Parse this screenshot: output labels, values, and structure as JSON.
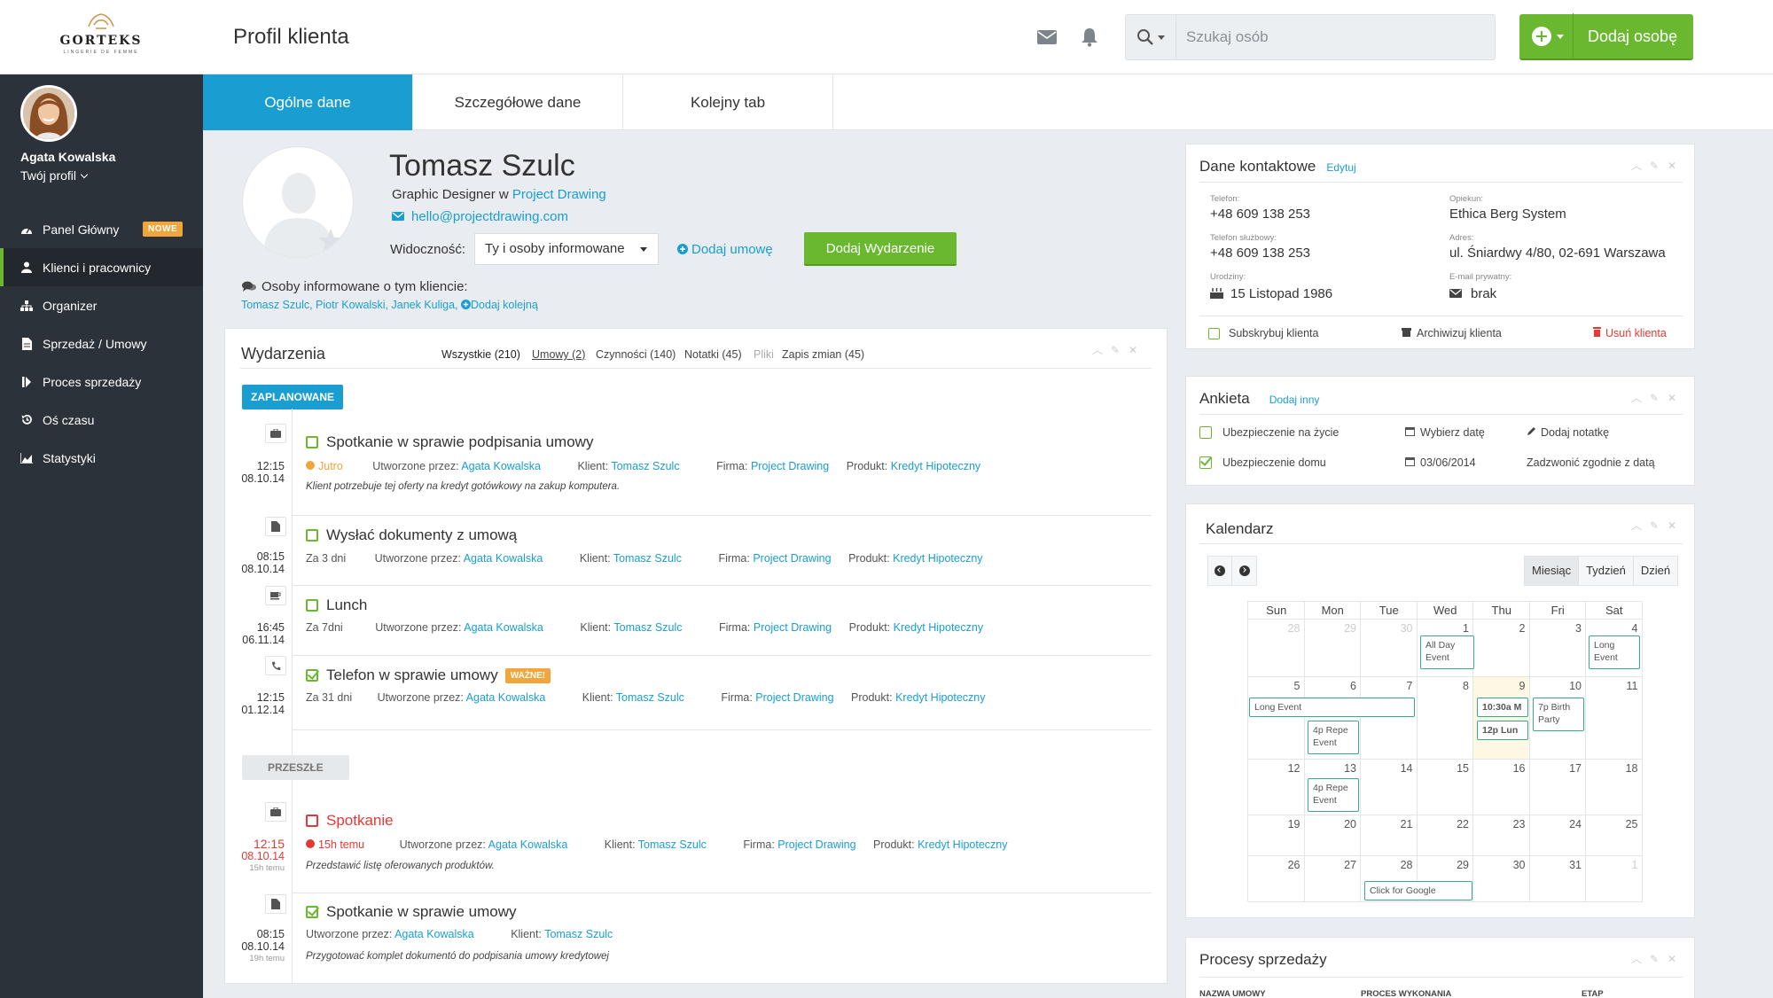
{
  "header": {
    "logo_brand": "GORTEKS",
    "logo_tagline": "LINGERIE DE FEMME",
    "page_title": "Profil klienta",
    "search_placeholder": "Szukaj osób",
    "add_person_label": "Dodaj osobę"
  },
  "sidebar": {
    "user_name": "Agata Kowalska",
    "user_profile_label": "Twój profil",
    "items": [
      {
        "label": "Panel Główny",
        "icon": "dashboard-icon",
        "badge": "NOWE"
      },
      {
        "label": "Klienci i pracownicy",
        "icon": "user-icon",
        "active": true
      },
      {
        "label": "Organizer",
        "icon": "organizer-icon"
      },
      {
        "label": "Sprzedaż / Umowy",
        "icon": "document-icon"
      },
      {
        "label": "Proces sprzedaży",
        "icon": "process-icon"
      },
      {
        "label": "Oś czasu",
        "icon": "history-icon"
      },
      {
        "label": "Statystyki",
        "icon": "chart-icon"
      }
    ]
  },
  "tabs": [
    "Ogólne dane",
    "Szczegółowe dane",
    "Kolejny tab"
  ],
  "profile": {
    "name": "Tomasz Szulc",
    "role_prefix": "Graphic Designer w ",
    "company": "Project Drawing",
    "email": "hello@projectdrawing.com",
    "visibility_label": "Widoczność:",
    "visibility_value": "Ty i osoby informowane",
    "add_contract": "Dodaj umowę",
    "add_event": "Dodaj Wydarzenie",
    "informed_title": "Osoby informowane o tym kliencie:",
    "informed_people": "Tomasz Szulc, Piotr Kowalski, Janek Kuliga,",
    "informed_add": "Dodaj kolejną"
  },
  "events": {
    "title": "Wydarzenia",
    "filters": [
      "Wszystkie (210)",
      "Umowy (2)",
      "Czynności (140)",
      "Notatki (45)",
      "Pliki",
      "Zapis zmian (45)"
    ],
    "planned_label": "ZAPLANOWANE",
    "past_label": "PRZESZŁE",
    "created_by_label": "Utworzone przez:",
    "client_label": "Klient:",
    "company_label": "Firma:",
    "product_label": "Produkt:",
    "creator": "Agata Kowalska",
    "client": "Tomasz Szulc",
    "company": "Project Drawing",
    "product": "Kredyt Hipoteczny",
    "important_badge": "WAŻNE!",
    "items": [
      {
        "time": "12:15",
        "date": "08.10.14",
        "title": "Spotkanie w sprawie podpisania umowy",
        "when": "Jutro",
        "desc": "Klient potrzebuje tej oferty na kredyt gotówkowy na zakup komputera."
      },
      {
        "time": "08:15",
        "date": "08.10.14",
        "title": "Wysłać dokumenty z umową",
        "when": "Za 3 dni"
      },
      {
        "time": "16:45",
        "date": "06.11.14",
        "title": "Lunch",
        "when": "Za 7dni"
      },
      {
        "time": "12:15",
        "date": "01.12.14",
        "title": "Telefon w sprawie umowy",
        "when": "Za 31 dni"
      },
      {
        "time": "12:15",
        "date": "08.10.14",
        "ago": "15h temu",
        "title": "Spotkanie",
        "when": "15h temu",
        "desc": "Przedstawić listę oferowanych produktów."
      },
      {
        "time": "08:15",
        "date": "08.10.14",
        "ago": "19h temu",
        "title": "Spotkanie w sprawie umowy",
        "desc": "Przygotować komplet dokumentó do podpisania umowy kredytowej"
      }
    ]
  },
  "contact": {
    "title": "Dane kontaktowe",
    "edit": "Edytuj",
    "phone_label": "Telefon:",
    "phone": "+48 609 138 253",
    "keeper_label": "Opiekun:",
    "keeper": "Ethica Berg System",
    "work_phone_label": "Telefon służbowy:",
    "work_phone": "+48 609 138 253",
    "address_label": "Adres:",
    "address": "ul. Śniardwy 4/80, 02-691 Warszawa",
    "birthday_label": "Urodziny:",
    "birthday": "15 Listopad 1986",
    "private_email_label": "E-mail prywatny:",
    "private_email": "brak",
    "subscribe": "Subskrybuj klienta",
    "archive": "Archiwizuj klienta",
    "delete": "Usuń klienta"
  },
  "survey": {
    "title": "Ankieta",
    "add_other": "Dodaj inny",
    "rows": [
      {
        "label": "Ubezpieczenie na życie",
        "date": "Wybierz datę",
        "note": "Dodaj notatkę",
        "checked": false
      },
      {
        "label": "Ubezpieczenie domu",
        "date": "03/06/2014",
        "note": "Zadzwonić zgodnie z datą",
        "checked": true
      }
    ]
  },
  "calendar": {
    "title": "Kalendarz",
    "views": [
      "Miesiąc",
      "Tydzień",
      "Dzień"
    ],
    "days": [
      "Sun",
      "Mon",
      "Tue",
      "Wed",
      "Thu",
      "Fri",
      "Sat"
    ],
    "weeks": [
      [
        "28",
        "29",
        "30",
        "1",
        "2",
        "3",
        "4"
      ],
      [
        "5",
        "6",
        "7",
        "8",
        "9",
        "10",
        "11"
      ],
      [
        "12",
        "13",
        "14",
        "15",
        "16",
        "17",
        "18"
      ],
      [
        "19",
        "20",
        "21",
        "22",
        "23",
        "24",
        "25"
      ],
      [
        "26",
        "27",
        "28",
        "29",
        "30",
        "31",
        "1"
      ]
    ],
    "events": {
      "all_day": "All Day Event",
      "long_event_1": "Long Event",
      "long_event_2": "Long Event",
      "repeat_1": "4p Repe Event",
      "repeat_2": "4p Repe Event",
      "meeting": "10:30a M",
      "lunch": "12p Lun",
      "birthday": "7p Birth Party",
      "google": "Click for Google"
    }
  },
  "processes": {
    "title": "Procesy sprzedaży",
    "columns": [
      "NAZWA UMOWY",
      "PROCES WYKONANIA",
      "ETAP"
    ]
  },
  "colors": {
    "accent_blue": "#1a9ed1",
    "green": "#6ab830",
    "sidebar": "#2c323a",
    "orange": "#f1a63b",
    "red": "#e53935"
  }
}
